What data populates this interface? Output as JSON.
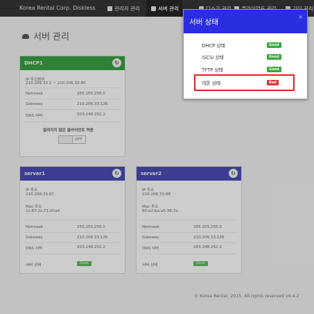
{
  "nav": {
    "brand": "Korea Rental Corp. Diskless",
    "items": [
      {
        "label": "관리자 관리",
        "icon": "user-icon"
      },
      {
        "label": "서버 관리",
        "icon": "cloud-icon"
      },
      {
        "label": "디스크 관리",
        "icon": "disk-icon"
      },
      {
        "label": "클라이언트 관리",
        "icon": "monitor-icon"
      },
      {
        "label": "기타 관리",
        "icon": "settings-icon"
      }
    ]
  },
  "page": {
    "title": "서버 관리"
  },
  "dhcp": {
    "title": "DHCP1",
    "ip_label": "IP 주소범위",
    "ip_value": "210.206.33.1 ~ 210.206.33.80",
    "netmask_label": "Netmask",
    "netmask_value": "255.255.255.0",
    "gateway_label": "Gateway",
    "gateway_value": "210.206.33.126",
    "dns_label": "DNS 서버",
    "dns_value": "203.248.252.2",
    "unknown_label": "알려지지 않은 클라이언트 허용",
    "toggle_value": "OFF"
  },
  "server1": {
    "title": "server1",
    "ip_label": "IP 주소",
    "ip_value": "210.206.33.87",
    "mac_label": "Mac 주소",
    "mac_value": "1c:87:2c:71:2f:a4",
    "netmask_label": "Netmask",
    "netmask_value": "255.255.255.0",
    "gateway_label": "Gateway",
    "gateway_value": "210.206.33.126",
    "dns_label": "DNS 서버",
    "dns_value": "203.248.252.2",
    "status_label": "서버 상태",
    "status_value": "Good"
  },
  "server2": {
    "title": "server2",
    "ip_label": "IP 주소",
    "ip_value": "210.206.33.88",
    "mac_label": "Mac 주소",
    "mac_value": "90:e2:ba:a5:36:7a",
    "netmask_label": "Netmask",
    "netmask_value": "255.255.255.0",
    "gateway_label": "Gateway",
    "gateway_value": "210.206.33.126",
    "dns_label": "DNS 서버",
    "dns_value": "203.248.252.2",
    "status_label": "서버 상태",
    "status_value": "Good"
  },
  "footer": {
    "text": "© Korea Rental. 2015. All rights reserved v4.4.2"
  },
  "modal": {
    "title": "서버 상태",
    "close": "×",
    "rows": [
      {
        "label": "DHCP 상태",
        "status": "Good"
      },
      {
        "label": "iSCSI 상태",
        "status": "Good"
      },
      {
        "label": "TFTP 상태",
        "status": "Good"
      },
      {
        "label": "데몬 상태",
        "status": "Bad"
      }
    ]
  },
  "colors": {
    "dhcp_header": "#0d8c1a",
    "server_header": "#2222a8",
    "modal_header": "#2b2ee0",
    "good": "#3aa63a",
    "bad": "#d9353a",
    "highlight": "#e02020"
  }
}
